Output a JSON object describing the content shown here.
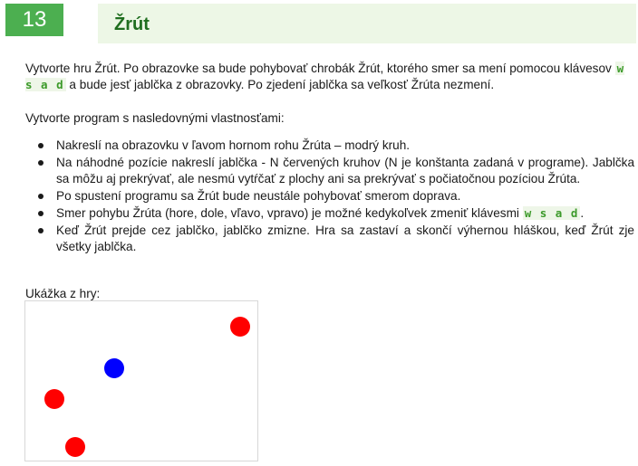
{
  "header": {
    "number": "13",
    "title": "Žrút"
  },
  "intro": {
    "before_keys": "Vytvorte hru Žrút. Po obrazovke sa bude pohybovať chrobák Žrút, ktorého smer sa mení pomocou klávesov ",
    "keys": "w s a d",
    "after_keys": " a bude jesť jablčka z obrazovky. Po zjedení jablčka sa veľkosť Žrúta nezmení."
  },
  "lead": "Vytvorte program s nasledovnými vlastnosťami:",
  "items": [
    "Nakreslí na obrazovku v ľavom hornom rohu Žrúta – modrý kruh.",
    "Na náhodné pozície nakreslí jablčka - N červených kruhov (N je konštanta zadaná v programe). Jablčka sa môžu aj prekrývať, ale nesmú vytŕčať z plochy ani sa prekrývať s počiatočnou pozíciou Žrúta.",
    "Po spustení programu sa Žrút bude neustále pohybovať smerom doprava.",
    {
      "before_keys": "Smer pohybu Žrúta (hore, dole, vľavo, vpravo) je možné kedykoľvek zmeniť klávesmi ",
      "keys": "w s a d",
      "after_keys": "."
    },
    "Keď Žrút prejde cez jablčko, jablčko zmizne. Hra sa zastaví a skončí výhernou hláškou, keď Žrút zje všetky jablčka."
  ],
  "sample_label": "Ukážka z hry:",
  "colors": {
    "zrut": "#0000ff",
    "apple": "#ff0000"
  }
}
